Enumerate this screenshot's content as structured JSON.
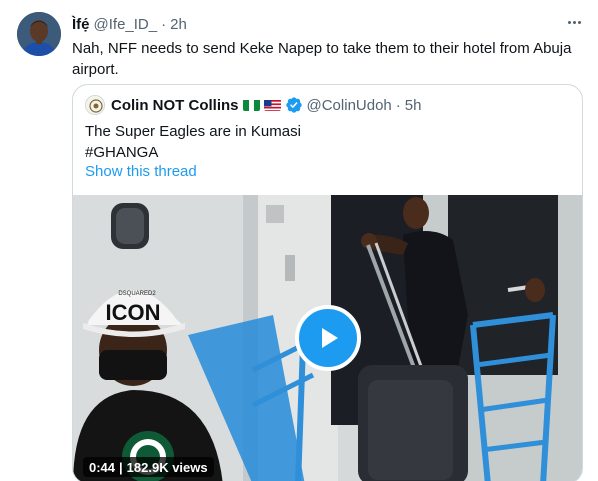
{
  "tweet": {
    "author_name": "Ìfẹ́",
    "author_handle": "@Ife_ID_",
    "separator": "·",
    "time": "2h",
    "text": "Nah, NFF needs to send Keke Napep to take them to their hotel from Abuja airport."
  },
  "quoted": {
    "author_name": "Colin NOT Collins",
    "author_handle": "@ColinUdoh",
    "separator": "·",
    "time": "5h",
    "text_line1": "The Super Eagles are in Kumasi",
    "text_line2": "#GHANGA",
    "show_thread": "Show this thread",
    "media": {
      "duration": "0:44",
      "separator": "|",
      "views": "182.9K views",
      "cap_text": "ICON",
      "cap_small_text": "DSQUARED2"
    }
  },
  "colors": {
    "accent": "#1d9bf0",
    "secondary_text": "#536471",
    "border": "#cfd9de"
  },
  "icons": [
    "more-icon",
    "verified-badge-icon",
    "nigeria-flag-icon",
    "us-flag-icon",
    "play-icon"
  ]
}
